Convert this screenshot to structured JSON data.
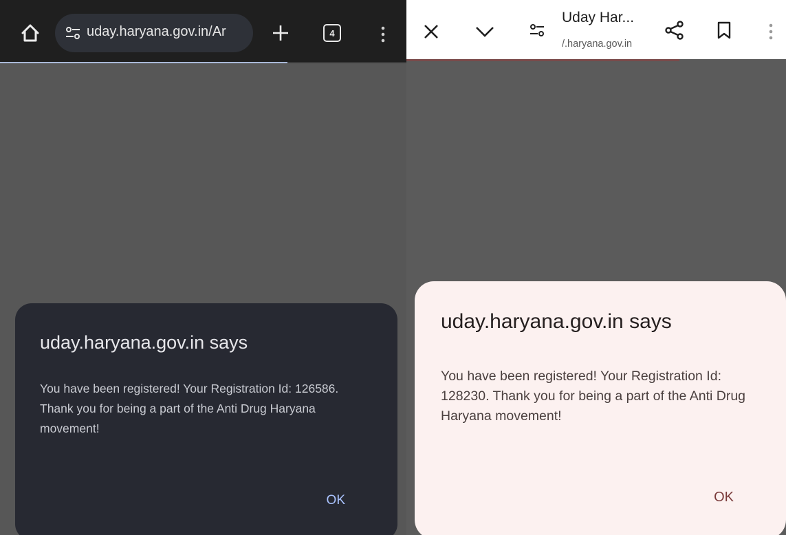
{
  "left_browser": {
    "omnibox_url": "uday.haryana.gov.in/Ar",
    "tab_count": "4",
    "dialog": {
      "title": "uday.haryana.gov.in says",
      "message": "You have been registered! Your Registration Id: 126586. Thank you for being a part of the Anti Drug Haryana movement!",
      "ok_label": "OK"
    },
    "icons": [
      "home-icon",
      "tune-icon",
      "plus-icon",
      "tab-switcher-icon",
      "more-vert-icon"
    ]
  },
  "right_browser": {
    "page_title": "Uday Har...",
    "url": "/.haryana.gov.in",
    "dialog": {
      "title": "uday.haryana.gov.in says",
      "message": "You have been registered! Your Registration Id: 128230. Thank you for being a part of the Anti Drug Haryana movement!",
      "ok_label": "OK"
    },
    "icons": [
      "close-icon",
      "chevron-down-icon",
      "tune-icon",
      "share-icon",
      "bookmark-icon",
      "more-vert-icon"
    ]
  },
  "colors": {
    "left_toolbar": "#1f1f1f",
    "left_dialog": "#272932",
    "left_ok": "#aac3ff",
    "scrim": "#575757",
    "right_dialog": "#fcf1f0",
    "right_ok": "#7a3b3b"
  }
}
